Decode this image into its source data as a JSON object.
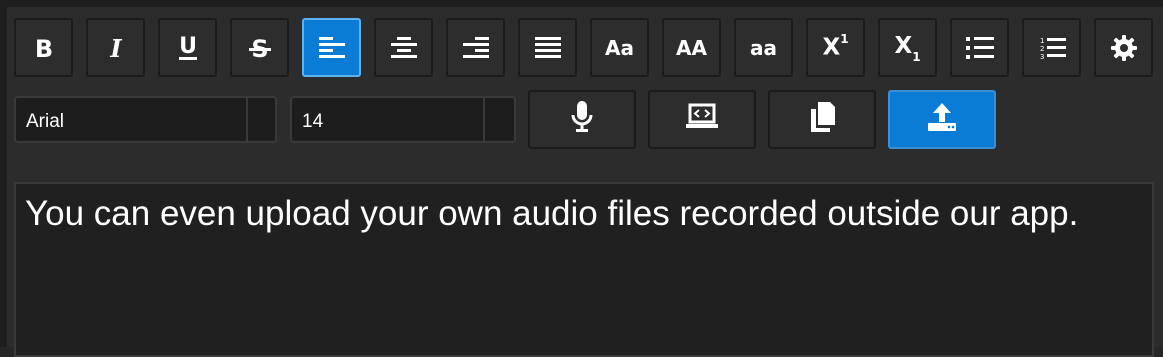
{
  "toolbar": {
    "format_buttons": [
      {
        "name": "bold-button",
        "icon": "bold-icon",
        "active": false
      },
      {
        "name": "italic-button",
        "icon": "italic-icon",
        "active": false
      },
      {
        "name": "underline-button",
        "icon": "underline-icon",
        "active": false
      },
      {
        "name": "strikethrough-button",
        "icon": "strikethrough-icon",
        "active": false
      },
      {
        "name": "align-left-button",
        "icon": "align-left-icon",
        "active": true
      },
      {
        "name": "align-center-button",
        "icon": "align-center-icon",
        "active": false
      },
      {
        "name": "align-right-button",
        "icon": "align-right-icon",
        "active": false
      },
      {
        "name": "align-justify-button",
        "icon": "align-justify-icon",
        "active": false
      },
      {
        "name": "sentence-case-button",
        "label": "Aa",
        "active": false
      },
      {
        "name": "uppercase-button",
        "label": "AA",
        "active": false
      },
      {
        "name": "lowercase-button",
        "label": "aa",
        "active": false
      },
      {
        "name": "superscript-button",
        "label": "X",
        "sup": "1",
        "active": false
      },
      {
        "name": "subscript-button",
        "label": "X",
        "sub": "1",
        "active": false
      },
      {
        "name": "bullet-list-button",
        "icon": "bullet-list-icon",
        "active": false
      },
      {
        "name": "numbered-list-button",
        "icon": "numbered-list-icon",
        "active": false
      },
      {
        "name": "settings-button",
        "icon": "gear-icon",
        "active": false
      }
    ],
    "font_family": "Arial",
    "font_size": "14",
    "action_buttons": [
      {
        "name": "record-button",
        "icon": "microphone-icon",
        "active": false
      },
      {
        "name": "embed-button",
        "icon": "laptop-code-icon",
        "active": false
      },
      {
        "name": "copy-button",
        "icon": "copy-icon",
        "active": false
      },
      {
        "name": "upload-button",
        "icon": "upload-icon",
        "active": true
      }
    ]
  },
  "editor": {
    "text": "You can even upload your own audio files recorded outside our app."
  },
  "colors": {
    "accent": "#0a7cd6",
    "background": "#2c2c2c",
    "editor_background": "#202020"
  }
}
